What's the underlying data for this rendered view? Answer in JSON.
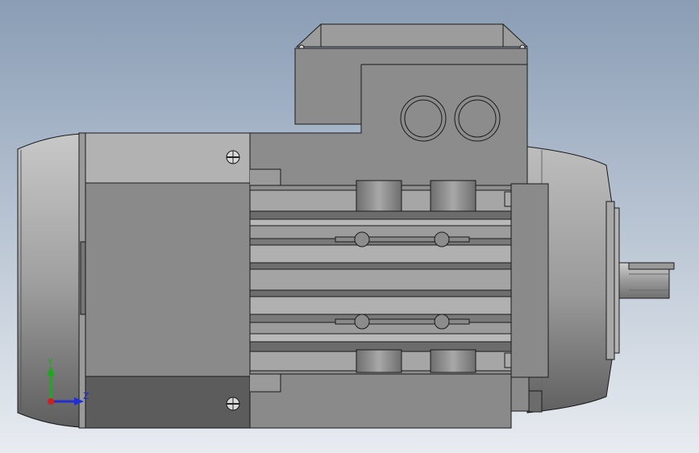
{
  "viewport": {
    "background_top": "#8a9db5",
    "background_bottom": "#e8ecf1"
  },
  "model": {
    "body_color": "#8a8a8a",
    "light_color": "#b4b4b4",
    "dark_color": "#5a5a5a",
    "edge_color": "#1a1a1a"
  },
  "triad": {
    "y_label": "Y",
    "z_label": "Z",
    "y_color": "#1fa81f",
    "z_color": "#1f2fd0",
    "x_color": "#d01f1f"
  }
}
